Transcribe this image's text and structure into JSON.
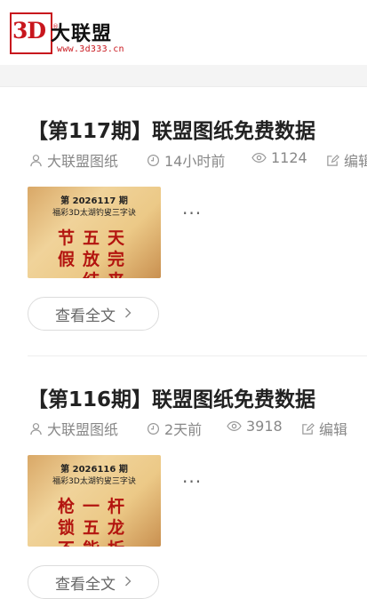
{
  "logo": {
    "mark": "3D",
    "registered": "®",
    "name": "大联盟",
    "url": "www.3d333.cn"
  },
  "posts": [
    {
      "title": "【第117期】联盟图纸免费数据",
      "author": "大联盟图纸",
      "time": "14小时前",
      "views": "1124",
      "edit": "编辑",
      "thumb_issue": "第 2026117 期",
      "thumb_sub": "福彩3D太湖钓叟三字诀",
      "thumb_lines": [
        "节五天",
        "假放完",
        "一结来"
      ],
      "excerpt": "...",
      "read_more": "查看全文"
    },
    {
      "title": "【第116期】联盟图纸免费数据",
      "author": "大联盟图纸",
      "time": "2天前",
      "views": "3918",
      "edit": "编辑",
      "thumb_issue": "第 2026116 期",
      "thumb_sub": "福彩3D太湖钓叟三字诀",
      "thumb_lines": [
        "枪一杆",
        "锁五龙",
        "不能折"
      ],
      "excerpt": "...",
      "read_more": "查看全文"
    }
  ],
  "colors": {
    "brand": "#c8161d",
    "poem": "#b3140f"
  },
  "icons": [
    "user-icon",
    "clock-icon",
    "eye-icon",
    "edit-icon",
    "chevron-right-icon"
  ]
}
